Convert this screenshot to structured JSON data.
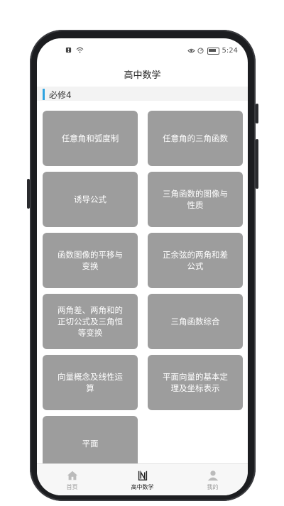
{
  "app": {
    "title": "高中数学"
  },
  "status": {
    "time": "5:24"
  },
  "section": {
    "title": "必修4"
  },
  "topics": [
    "任意角和弧度制",
    "任意角的三角函数",
    "诱导公式",
    "三角函数的图像与性质",
    "函数图像的平移与变换",
    "正余弦的两角和差公式",
    "两角差、两角和的正切公式及三角恒等变换",
    "三角函数综合",
    "向量概念及线性运算",
    "平面向量的基本定理及坐标表示",
    "平面"
  ],
  "nav": [
    {
      "label": "首页",
      "icon": "home-icon"
    },
    {
      "label": "高中数学",
      "icon": "book-icon"
    },
    {
      "label": "我的",
      "icon": "user-icon"
    }
  ],
  "colors": {
    "accent": "#2ea3e0",
    "card": "#9d9d9d"
  }
}
